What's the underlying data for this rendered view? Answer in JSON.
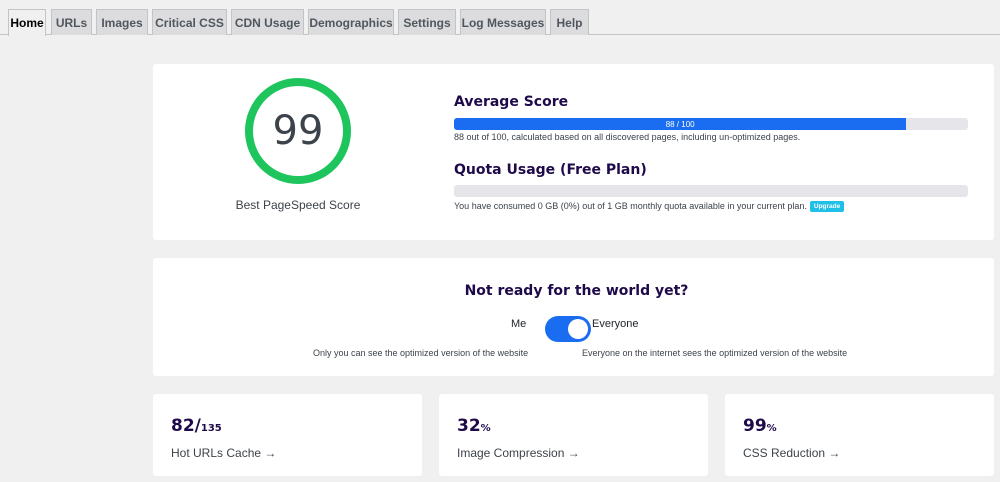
{
  "tabs": [
    {
      "label": "Home",
      "active": true
    },
    {
      "label": "URLs"
    },
    {
      "label": "Images"
    },
    {
      "label": "Critical CSS"
    },
    {
      "label": "CDN Usage"
    },
    {
      "label": "Demographics"
    },
    {
      "label": "Settings"
    },
    {
      "label": "Log Messages"
    },
    {
      "label": "Help"
    }
  ],
  "score": {
    "value": "99",
    "label": "Best PageSpeed Score",
    "ring_color": "#1ec45c"
  },
  "average": {
    "title": "Average Score",
    "bar_label": "88 / 100",
    "fraction": 0.88,
    "description": "88 out of 100, calculated based on all discovered pages, including un-optimized pages."
  },
  "quota": {
    "title": "Quota Usage (Free Plan)",
    "fraction": 0,
    "description": "You have consumed 0 GB (0%) out of 1 GB monthly quota available in your current plan.",
    "upgrade_label": "Upgrade"
  },
  "visibility": {
    "title": "Not ready for the world yet?",
    "left_label": "Me",
    "right_label": "Everyone",
    "toggle_on": true,
    "left_desc": "Only you can see the optimized version of the website",
    "right_desc": "Everyone on the internet sees the optimized version of the website"
  },
  "stats": [
    {
      "value": "82/",
      "suffix": "135",
      "link": "Hot URLs Cache →"
    },
    {
      "value": "32",
      "suffix": "%",
      "link": "Image Compression →"
    },
    {
      "value": "99",
      "suffix": "%",
      "link": "CSS Reduction →"
    }
  ],
  "colors": {
    "accent": "#1a6cf0",
    "heading": "#1e0a4a",
    "upgrade_badge": "#1ec0e8"
  }
}
